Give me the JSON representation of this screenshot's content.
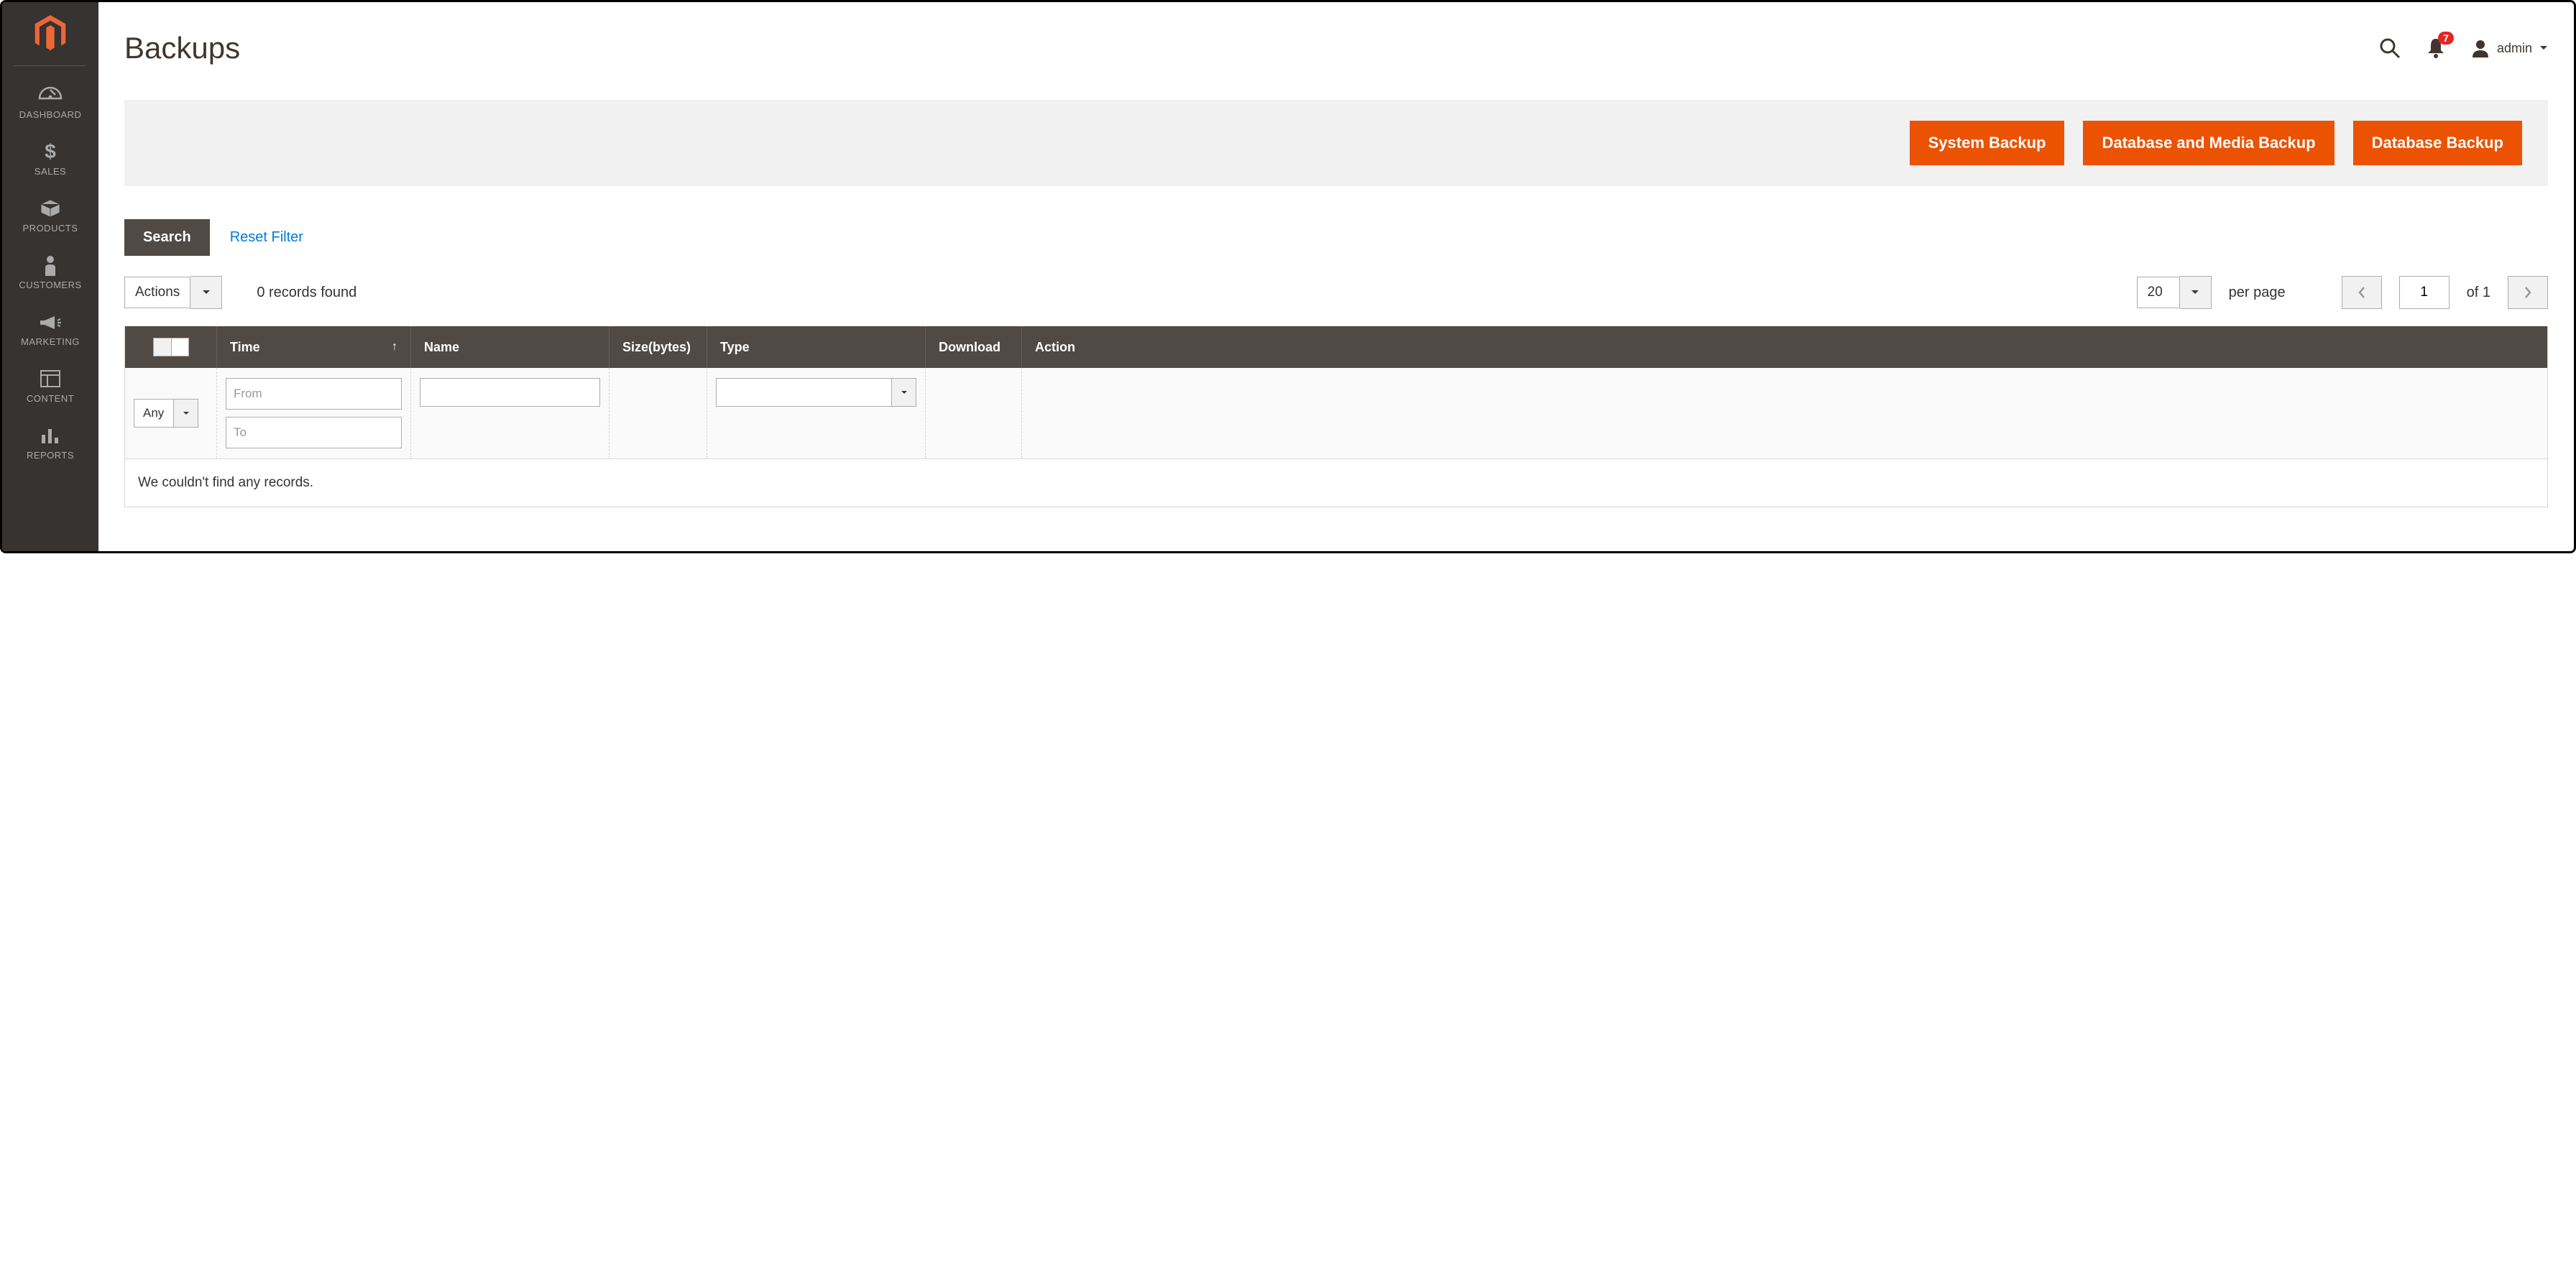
{
  "sidebar": {
    "items": [
      {
        "label": "DASHBOARD"
      },
      {
        "label": "SALES"
      },
      {
        "label": "PRODUCTS"
      },
      {
        "label": "CUSTOMERS"
      },
      {
        "label": "MARKETING"
      },
      {
        "label": "CONTENT"
      },
      {
        "label": "REPORTS"
      }
    ]
  },
  "header": {
    "title": "Backups",
    "notification_count": "7",
    "user_label": "admin"
  },
  "action_buttons": {
    "system_backup": "System Backup",
    "db_media_backup": "Database and Media Backup",
    "db_backup": "Database Backup"
  },
  "filter": {
    "search_label": "Search",
    "reset_label": "Reset Filter"
  },
  "toolbar": {
    "actions_label": "Actions",
    "records_found": "0 records found",
    "page_size": "20",
    "per_page_label": "per page",
    "current_page": "1",
    "total_pages_label": "of 1"
  },
  "grid": {
    "columns": {
      "time": "Time",
      "name": "Name",
      "size": "Size(bytes)",
      "type": "Type",
      "download": "Download",
      "action": "Action"
    },
    "filters": {
      "any_label": "Any",
      "from_placeholder": "From",
      "to_placeholder": "To"
    },
    "empty_message": "We couldn't find any records."
  }
}
